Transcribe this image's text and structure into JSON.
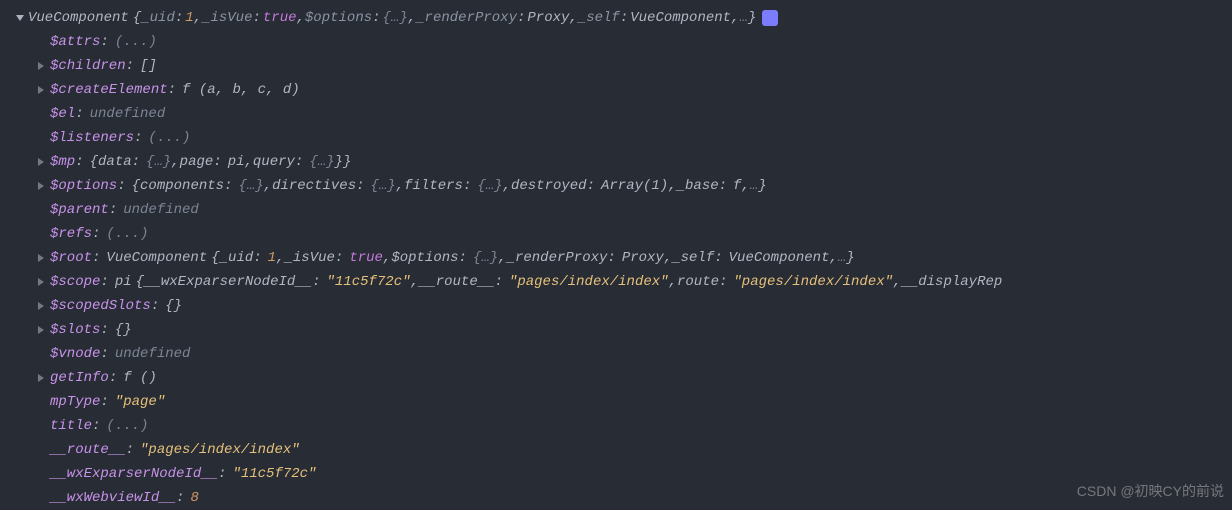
{
  "header": {
    "class": "VueComponent",
    "uid_key": "_uid",
    "uid_val": "1",
    "isVue_key": "_isVue",
    "isVue_val": "true",
    "opts_key": "$options",
    "opts_val": "{…}",
    "renderProxy_key": "_renderProxy",
    "renderProxy_val": "Proxy",
    "self_key": "_self",
    "self_val": "VueComponent",
    "more": "…"
  },
  "rows": {
    "attrs": {
      "key": "$attrs",
      "val": "(...)"
    },
    "children": {
      "key": "$children",
      "val": "[]"
    },
    "createEl": {
      "key": "$createElement",
      "fn": "f (a, b, c, d)"
    },
    "el": {
      "key": "$el",
      "val": "undefined"
    },
    "listeners": {
      "key": "$listeners",
      "val": "(...)"
    },
    "mp": {
      "key": "$mp",
      "data_k": "data",
      "data_v": "{…}",
      "page_k": "page",
      "page_v": "pi",
      "query_k": "query",
      "query_v": "{…}"
    },
    "options": {
      "key": "$options",
      "comp_k": "components",
      "comp_v": "{…}",
      "dir_k": "directives",
      "dir_v": "{…}",
      "fil_k": "filters",
      "fil_v": "{…}",
      "des_k": "destroyed",
      "des_v": "Array(1)",
      "base_k": "_base",
      "base_f": "f",
      "more": "…"
    },
    "parent": {
      "key": "$parent",
      "val": "undefined"
    },
    "refs": {
      "key": "$refs",
      "val": "(...)"
    },
    "root": {
      "key": "$root",
      "class": "VueComponent",
      "uid_k": "_uid",
      "uid_v": "1",
      "isVue_k": "_isVue",
      "isVue_v": "true",
      "opts_k": "$options",
      "opts_v": "{…}",
      "rp_k": "_renderProxy",
      "rp_v": "Proxy",
      "self_k": "_self",
      "self_v": "VueComponent",
      "more": "…"
    },
    "scope": {
      "key": "$scope",
      "class": "pi",
      "node_k": "__wxExparserNodeId__",
      "node_v": "\"11c5f72c\"",
      "route_k": "__route__",
      "route_v": "\"pages/index/index\"",
      "route2_k": "route",
      "route2_v": "\"pages/index/index\"",
      "disp_k": "__displayRep"
    },
    "scopedSlots": {
      "key": "$scopedSlots",
      "val": "{}"
    },
    "slots": {
      "key": "$slots",
      "val": "{}"
    },
    "vnode": {
      "key": "$vnode",
      "val": "undefined"
    },
    "getInfo": {
      "key": "getInfo",
      "fn": "f ()"
    },
    "mpType": {
      "key": "mpType",
      "val": "\"page\""
    },
    "title": {
      "key": "title",
      "val": "(...)"
    },
    "route": {
      "key": "__route__",
      "val": "\"pages/index/index\""
    },
    "wxNode": {
      "key": "__wxExparserNodeId__",
      "val": "\"11c5f72c\""
    },
    "wxWeb": {
      "key": "__wxWebviewId__",
      "val": "8"
    }
  },
  "watermark": "CSDN @初映CY的前说"
}
